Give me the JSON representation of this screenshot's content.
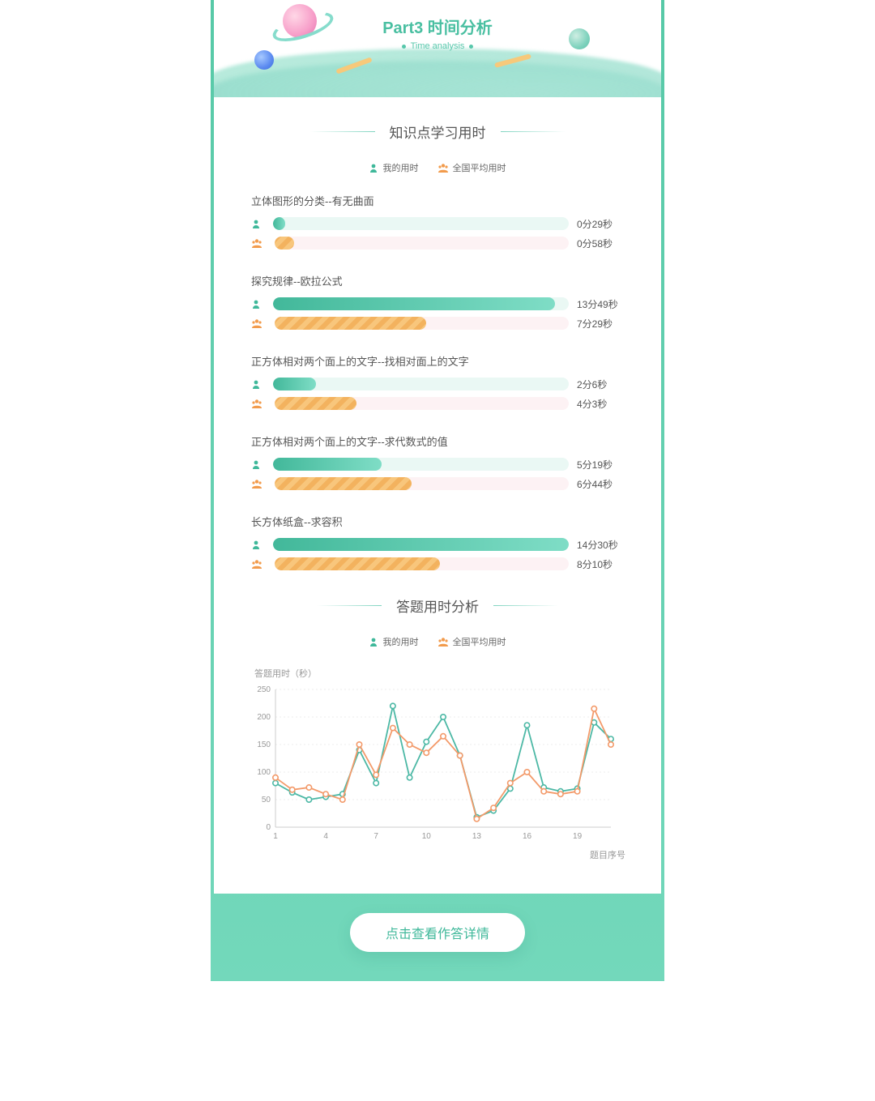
{
  "hero": {
    "title": "Part3 时间分析",
    "subtitle": "Time analysis"
  },
  "sections": {
    "study_title": "知识点学习用时",
    "answer_title": "答题用时分析"
  },
  "legend": {
    "mine": "我的用时",
    "avg": "全国平均用时"
  },
  "max_seconds": 870,
  "topics": [
    {
      "title": "立体图形的分类--有无曲面",
      "mine": {
        "label": "0分29秒",
        "seconds": 29
      },
      "avg": {
        "label": "0分58秒",
        "seconds": 58
      }
    },
    {
      "title": "探究规律--欧拉公式",
      "mine": {
        "label": "13分49秒",
        "seconds": 829
      },
      "avg": {
        "label": "7分29秒",
        "seconds": 449
      }
    },
    {
      "title": "正方体相对两个面上的文字--找相对面上的文字",
      "mine": {
        "label": "2分6秒",
        "seconds": 126
      },
      "avg": {
        "label": "4分3秒",
        "seconds": 243
      }
    },
    {
      "title": "正方体相对两个面上的文字--求代数式的值",
      "mine": {
        "label": "5分19秒",
        "seconds": 319
      },
      "avg": {
        "label": "6分44秒",
        "seconds": 404
      }
    },
    {
      "title": "长方体纸盒--求容积",
      "mine": {
        "label": "14分30秒",
        "seconds": 870
      },
      "avg": {
        "label": "8分10秒",
        "seconds": 490
      }
    }
  ],
  "chart_data": {
    "type": "line",
    "title": "",
    "ylabel": "答题用时（秒）",
    "xlabel": "题目序号",
    "ylim": [
      0,
      250
    ],
    "xticks": [
      1,
      4,
      7,
      10,
      13,
      16,
      19
    ],
    "yticks": [
      0,
      50,
      100,
      150,
      200,
      250
    ],
    "x": [
      1,
      2,
      3,
      4,
      5,
      6,
      7,
      8,
      9,
      10,
      11,
      12,
      13,
      14,
      15,
      16,
      17,
      18,
      19,
      20,
      21
    ],
    "series": [
      {
        "name": "我的用时",
        "color": "#4cb8a5",
        "values": [
          80,
          63,
          50,
          55,
          60,
          140,
          80,
          220,
          90,
          155,
          200,
          130,
          18,
          30,
          70,
          185,
          72,
          65,
          70,
          190,
          160
        ]
      },
      {
        "name": "全国平均用时",
        "color": "#f39a6a",
        "values": [
          90,
          68,
          72,
          60,
          50,
          150,
          95,
          180,
          150,
          135,
          165,
          130,
          15,
          35,
          80,
          100,
          65,
          60,
          65,
          215,
          150
        ]
      }
    ]
  },
  "cta": {
    "label": "点击查看作答详情"
  },
  "colors": {
    "mine": "#3fb89a",
    "avg": "#f29b4c"
  }
}
